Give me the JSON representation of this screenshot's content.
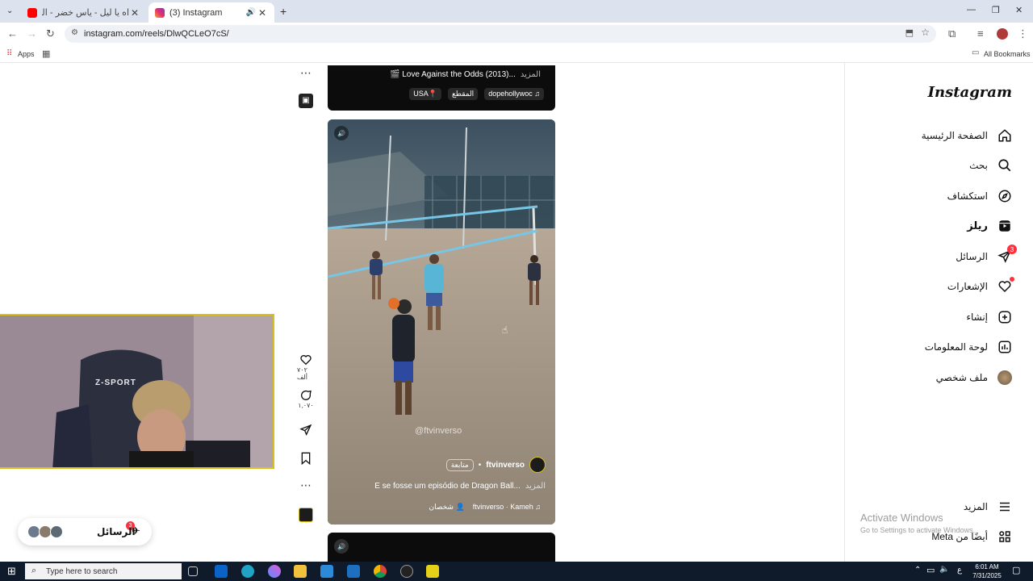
{
  "browser": {
    "tabs": [
      {
        "title": "اه يا ليل - ياس خضر - النسخة الأصلية",
        "icon": "youtube-icon"
      },
      {
        "title": "(3) Instagram",
        "icon": "instagram-icon",
        "audio": "speaker-icon"
      }
    ],
    "url": "instagram.com/reels/DlwQCLeO7cS/",
    "bookmarks": {
      "apps": "Apps",
      "all": "All Bookmarks"
    }
  },
  "sidebar": {
    "logo": "Instagram",
    "items": [
      {
        "label": "الصفحة الرئيسية",
        "icon": "home-icon"
      },
      {
        "label": "بحث",
        "icon": "search-icon"
      },
      {
        "label": "استكشاف",
        "icon": "explore-icon"
      },
      {
        "label": "ريلز",
        "icon": "reels-icon"
      },
      {
        "label": "الرسائل",
        "icon": "messenger-icon",
        "badge": "3"
      },
      {
        "label": "الإشعارات",
        "icon": "heart-icon"
      },
      {
        "label": "إنشاء",
        "icon": "plus-square-icon"
      },
      {
        "label": "لوحة المعلومات",
        "icon": "dashboard-icon"
      },
      {
        "label": "ملف شخصي",
        "icon": "profile-avatar"
      }
    ],
    "more": {
      "label": "المزيد",
      "icon": "menu-icon"
    },
    "meta": {
      "label": "أيضًا من Meta",
      "icon": "meta-apps-icon"
    }
  },
  "reel_prev": {
    "caption": "🎬 Love Against the Odds (2013)...",
    "more": "المزيد",
    "location": "USA",
    "audio_label": "المقطع",
    "audio_user": "dopehollywoc"
  },
  "reel_main": {
    "watermark": "@ftvinverso",
    "username": "ftvinverso",
    "follow": "متابعة",
    "caption": "E se fosse um episódio de Dragon Ball...",
    "more": "المزيد",
    "audio": "ftvinverso · Kameh",
    "tagged": "شخصان"
  },
  "actions": {
    "likes": "٧٠٢ ألف",
    "comments": "١,٠٧٠"
  },
  "messages_pill": {
    "label": "الرسائل",
    "badge": "3"
  },
  "windows": {
    "activate_title": "Activate Windows",
    "activate_sub": "Go to Settings to activate Windows.",
    "search_placeholder": "Type here to search",
    "time": "6:01 AM",
    "date": "7/31/2025",
    "lang": "ع"
  },
  "webcam": {
    "chair_text": "Z-SPORT"
  }
}
